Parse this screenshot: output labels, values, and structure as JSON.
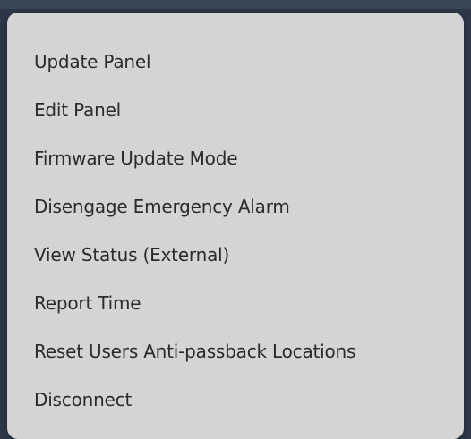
{
  "menu": {
    "items": [
      {
        "label": "Update Panel"
      },
      {
        "label": "Edit Panel"
      },
      {
        "label": "Firmware Update Mode"
      },
      {
        "label": "Disengage Emergency Alarm"
      },
      {
        "label": "View Status (External)"
      },
      {
        "label": "Report Time"
      },
      {
        "label": "Reset Users Anti-passback Locations"
      },
      {
        "label": "Disconnect"
      }
    ]
  },
  "colors": {
    "menu_background": "#d4d4d4",
    "menu_text": "#2b2b2b",
    "backdrop": "#2c3747"
  }
}
